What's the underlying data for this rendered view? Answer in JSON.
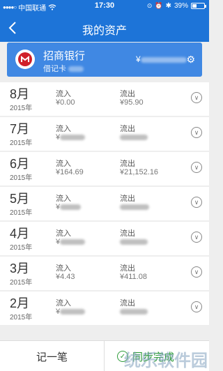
{
  "status_bar": {
    "carrier": "中国联通",
    "time": "17:30",
    "battery": "39%",
    "battery_level": 0.39
  },
  "header": {
    "title": "我的资产"
  },
  "card": {
    "bank_name": "招商银行",
    "card_type": "借记卡",
    "balance_prefix": "¥"
  },
  "months": [
    {
      "month": "8月",
      "year": "2015年",
      "in_label": "流入",
      "in_value": "¥0.00",
      "out_label": "流出",
      "out_value": "¥95.90"
    },
    {
      "month": "7月",
      "year": "2015年",
      "in_label": "流入",
      "in_value": "¥",
      "out_label": "流出",
      "out_value": ""
    },
    {
      "month": "6月",
      "year": "2015年",
      "in_label": "流入",
      "in_value": "¥164.69",
      "out_label": "流出",
      "out_value": "¥21,152.16"
    },
    {
      "month": "5月",
      "year": "2015年",
      "in_label": "流入",
      "in_value": "¥",
      "out_label": "流出",
      "out_value": ""
    },
    {
      "month": "4月",
      "year": "2015年",
      "in_label": "流入",
      "in_value": "¥",
      "out_label": "流出",
      "out_value": ""
    },
    {
      "month": "3月",
      "year": "2015年",
      "in_label": "流入",
      "in_value": "¥4.43",
      "out_label": "流出",
      "out_value": "¥411.08"
    },
    {
      "month": "2月",
      "year": "2015年",
      "in_label": "流入",
      "in_value": "¥",
      "out_label": "流出",
      "out_value": ""
    }
  ],
  "bottom": {
    "record_label": "记一笔",
    "sync_label": "同步完成"
  },
  "watermark": "统乐软件园",
  "colors": {
    "header": "#1d74d8",
    "card": "#4088e3",
    "sync": "#2e9c3a"
  }
}
